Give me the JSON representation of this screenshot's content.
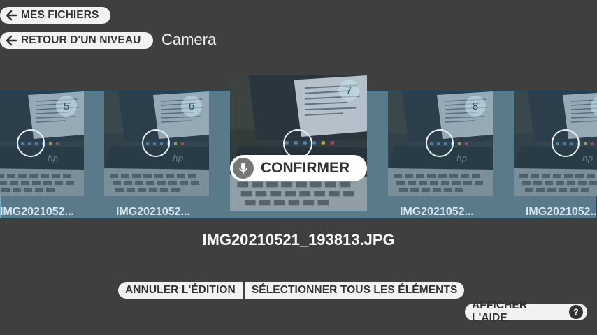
{
  "nav": {
    "my_files_label": "MES FICHIERS",
    "back_level_label": "RETOUR D'UN NIVEAU",
    "folder_title": "Camera"
  },
  "gallery": {
    "items": [
      {
        "number": "5",
        "caption": "IMG2021052..."
      },
      {
        "number": "6",
        "caption": "IMG2021052..."
      },
      {
        "number": "7",
        "caption": ""
      },
      {
        "number": "8",
        "caption": "IMG2021052..."
      },
      {
        "number": "",
        "caption": "IMG2021052..."
      }
    ],
    "confirm_label": "CONFIRMER"
  },
  "selected_file": "IMG20210521_193813.JPG",
  "actions": {
    "cancel_edit_label": "ANNULER L'ÉDITION",
    "select_all_label": "SÉLECTIONNER TOUS LES ÉLÉMENTS",
    "show_help_label": "AFFICHER L'AIDE",
    "help_icon_glyph": "?"
  },
  "colors": {
    "background": "#3f3f3f",
    "strip": "#5b7a89",
    "strip_border": "#7ab0c8",
    "pill": "#f2f2f2"
  }
}
